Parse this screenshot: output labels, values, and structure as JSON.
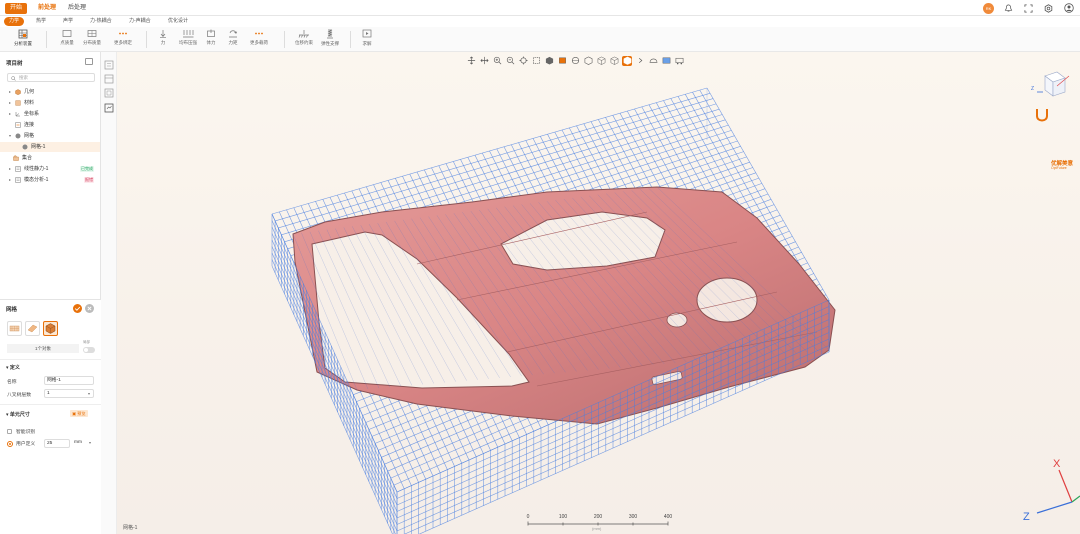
{
  "app": {
    "top_tabs": [
      {
        "label": "开始",
        "state": "active"
      },
      {
        "label": "前处理",
        "state": "selected"
      },
      {
        "label": "后处理",
        "state": "normal"
      }
    ],
    "user_badge": "RK"
  },
  "modules": [
    "力学",
    "热学",
    "声学",
    "力-热耦合",
    "力-声耦合",
    "优化设计"
  ],
  "ribbon": {
    "buttons": [
      {
        "label": "分析装置",
        "icon": "analysis-setup-icon"
      },
      {
        "label": "点质量",
        "icon": "point-mass-icon"
      },
      {
        "label": "分布质量",
        "icon": "distributed-mass-icon"
      },
      {
        "label": "更多绑定",
        "icon": "more-binding-icon"
      },
      {
        "label": "力",
        "icon": "force-icon"
      },
      {
        "label": "均布压强",
        "icon": "uniform-pressure-icon"
      },
      {
        "label": "体力",
        "icon": "body-force-icon"
      },
      {
        "label": "力矩",
        "icon": "moment-icon"
      },
      {
        "label": "更多载荷",
        "icon": "more-loads-icon"
      },
      {
        "label": "位移约束",
        "icon": "displacement-constraint-icon"
      },
      {
        "label": "弹性支撑",
        "icon": "elastic-support-icon"
      },
      {
        "label": "求解",
        "icon": "solve-icon"
      }
    ]
  },
  "project_tree": {
    "title": "项目树",
    "search_placeholder": "搜索",
    "items": [
      {
        "label": "几何",
        "arrow": "▸",
        "badge": ""
      },
      {
        "label": "材料",
        "arrow": "▸",
        "badge": ""
      },
      {
        "label": "坐标系",
        "arrow": "▸",
        "badge": ""
      },
      {
        "label": "连接",
        "arrow": "",
        "badge": ""
      },
      {
        "label": "网格",
        "arrow": "▾",
        "badge": ""
      },
      {
        "label": "网格-1",
        "arrow": "",
        "badge": ""
      },
      {
        "label": "集合",
        "arrow": "",
        "badge": ""
      },
      {
        "label": "线性静力-1",
        "arrow": "▸",
        "badge": "已完成"
      },
      {
        "label": "模态分析-1",
        "arrow": "▸",
        "badge": "报错"
      }
    ]
  },
  "mesh_panel": {
    "title": "网格",
    "object_count": "1个对象",
    "toggle_label": "局部",
    "definition_section": "定义",
    "name_label": "名称",
    "name_value": "网格-1",
    "octree_label": "八叉树层数",
    "octree_value": "1",
    "element_size_section": "单元尺寸",
    "preview_label": "预览",
    "smart_label": "智能识别",
    "user_defined_label": "用户定义",
    "size_value": "25",
    "size_unit": "mm"
  },
  "viewport": {
    "status_text": "网格-1",
    "scale_ticks": [
      "0",
      "100",
      "200",
      "300",
      "400"
    ],
    "scale_unit": "(mm)",
    "logo_text": "优解美意",
    "logo_sub": "OptFuture",
    "axis_labels": {
      "x": "X",
      "z": "Z"
    },
    "mesh_color": "#4a7fe0",
    "part_color": "#d98585",
    "accent": "#e8710a"
  }
}
